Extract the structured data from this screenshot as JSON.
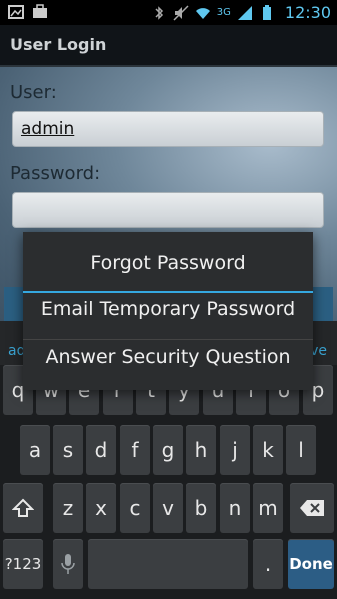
{
  "status_bar": {
    "time": "12:30",
    "network": "3G",
    "icons": [
      "photo-icon",
      "briefcase-icon",
      "bluetooth-icon",
      "mute-icon",
      "wifi-icon",
      "signal-icon",
      "battery-icon"
    ]
  },
  "app": {
    "title": "User Login"
  },
  "form": {
    "user_label": "User:",
    "user_value": "admin",
    "password_label": "Password:",
    "password_value": ""
  },
  "dialog": {
    "items": [
      "Forgot Password",
      "Email Temporary Password",
      "Answer Security Question"
    ]
  },
  "keyboard": {
    "suggestions": {
      "left": "ad",
      "right": "ve"
    },
    "row1": [
      "q",
      "w",
      "e",
      "r",
      "t",
      "y",
      "u",
      "i",
      "o",
      "p"
    ],
    "row2": [
      "a",
      "s",
      "d",
      "f",
      "g",
      "h",
      "j",
      "k",
      "l"
    ],
    "row3": [
      "z",
      "x",
      "c",
      "v",
      "b",
      "n",
      "m"
    ],
    "symbols_key": "?123",
    "period_key": ".",
    "done_key": "Done"
  },
  "colors": {
    "accent": "#35a8e0",
    "done_key_bg": "#2c5d85",
    "background_gradient": "#6f879a"
  }
}
